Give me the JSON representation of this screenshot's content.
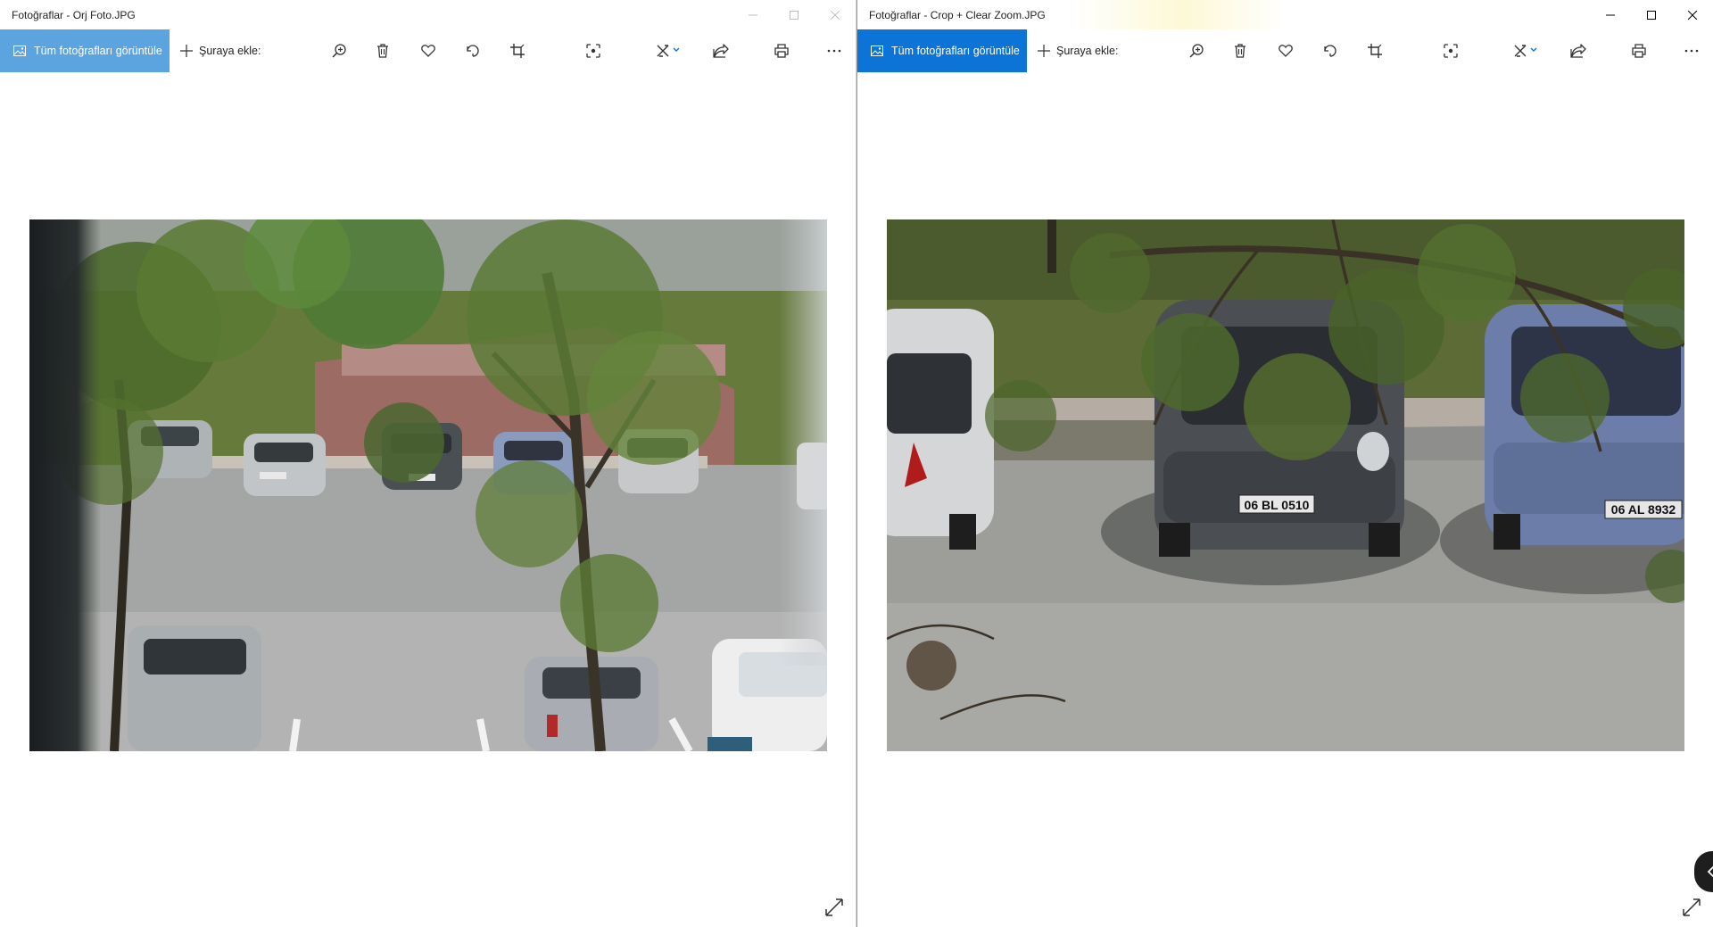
{
  "left_window": {
    "title": "Fotoğraflar - Orj Foto.JPG",
    "state": "inactive",
    "toolbar": {
      "view_all_label": "Tüm fotoğrafları görüntüle",
      "add_to_label": "Şuraya ekle:"
    }
  },
  "right_window": {
    "title": "Fotoğraflar - Crop + Clear Zoom.JPG",
    "state": "active",
    "toolbar": {
      "view_all_label": "Tüm fotoğrafları görüntüle",
      "add_to_label": "Şuraya ekle:"
    },
    "photo_plates": {
      "left_car": "06 BL 0510",
      "right_car": "06 AL 8932"
    }
  },
  "icons": {
    "toolbar": [
      "photos-icon",
      "plus-icon",
      "zoom-in-icon",
      "delete-icon",
      "heart-icon",
      "rotate-icon",
      "crop-icon",
      "focus-icon",
      "edit-create-icon",
      "share-icon",
      "print-icon",
      "more-icon"
    ],
    "window": [
      "minimize-icon",
      "maximize-icon",
      "close-icon"
    ],
    "viewer": [
      "expand-icon"
    ]
  },
  "colors": {
    "accent_active": "#0c74d6",
    "accent_inactive": "#5ba4e0",
    "background": "#ffffff"
  }
}
